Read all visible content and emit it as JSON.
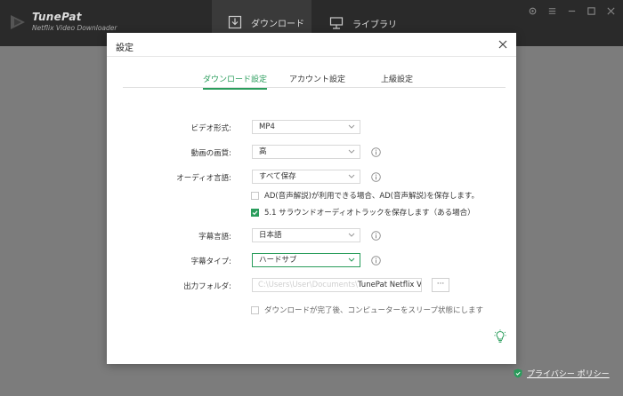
{
  "app": {
    "brand_name": "TunePat",
    "brand_sub": "Netflix Video Downloader",
    "nav": [
      {
        "label": "ダウンロード"
      },
      {
        "label": "ライブラリ"
      }
    ],
    "privacy_label": "プライバシー ポリシー"
  },
  "dialog": {
    "title": "設定",
    "tabs": [
      {
        "label": "ダウンロード設定"
      },
      {
        "label": "アカウント設定"
      },
      {
        "label": "上級設定"
      }
    ],
    "video_format": {
      "label": "ビデオ形式:",
      "value": "MP4"
    },
    "video_quality": {
      "label": "動画の画質:",
      "value": "高"
    },
    "audio_language": {
      "label": "オーディオ言語:",
      "value": "すべて保存"
    },
    "ad_option": {
      "label": "AD(音声解説)が利用できる場合、AD(音声解説)を保存します。",
      "checked": false
    },
    "surround_option": {
      "label": "5.1 サラウンドオーディオトラックを保存します（ある場合）",
      "checked": true
    },
    "subtitle_language": {
      "label": "字幕言語:",
      "value": "日本語"
    },
    "subtitle_type": {
      "label": "字幕タイプ:",
      "value": "ハードサブ"
    },
    "output_folder": {
      "label": "出力フォルダ:",
      "value_hidden": "C:\\Users\\User\\Documents\\",
      "value": "TunePat Netflix Vi",
      "browse_label": "···"
    },
    "sleep_option": {
      "label": "ダウンロードが完了後、コンピューターをスリープ状態にします",
      "checked": false
    }
  },
  "colors": {
    "accent": "#2a9d5c",
    "title_bar": "#2a2a2a",
    "overlay_bg": "#7c7c7c"
  }
}
